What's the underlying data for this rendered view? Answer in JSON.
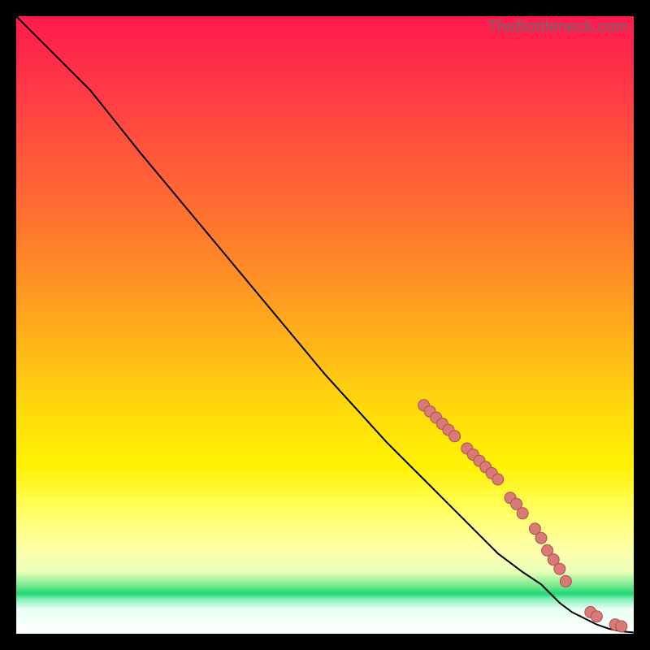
{
  "watermark": "TheBottleneck.com",
  "colors": {
    "line": "#000000",
    "marker_fill": "#d77a78",
    "marker_stroke": "#b24f4d"
  },
  "chart_data": {
    "type": "line",
    "title": "",
    "xlabel": "",
    "ylabel": "",
    "xlim": [
      0,
      100
    ],
    "ylim": [
      0,
      100
    ],
    "grid": false,
    "legend": false,
    "series": [
      {
        "name": "curve",
        "x": [
          0,
          4,
          8,
          12,
          20,
          30,
          40,
          50,
          60,
          66,
          70,
          74,
          78,
          82,
          85,
          88,
          90,
          92,
          94,
          96,
          98,
          100
        ],
        "y": [
          100,
          96,
          92,
          88,
          78,
          66,
          54,
          42,
          31,
          25,
          21,
          17,
          13,
          10,
          8,
          5,
          3.5,
          2.5,
          1.5,
          0.8,
          0.4,
          0.2
        ]
      }
    ],
    "markers": [
      {
        "x": 66,
        "y": 37
      },
      {
        "x": 67,
        "y": 36
      },
      {
        "x": 68,
        "y": 35
      },
      {
        "x": 69,
        "y": 34
      },
      {
        "x": 70,
        "y": 33
      },
      {
        "x": 71,
        "y": 32
      },
      {
        "x": 73,
        "y": 30
      },
      {
        "x": 74,
        "y": 29
      },
      {
        "x": 75,
        "y": 28
      },
      {
        "x": 76,
        "y": 27
      },
      {
        "x": 77,
        "y": 26
      },
      {
        "x": 78,
        "y": 25
      },
      {
        "x": 80,
        "y": 22
      },
      {
        "x": 81,
        "y": 21
      },
      {
        "x": 82,
        "y": 19.5
      },
      {
        "x": 84,
        "y": 17
      },
      {
        "x": 85,
        "y": 15.5
      },
      {
        "x": 86,
        "y": 13.5
      },
      {
        "x": 87,
        "y": 12
      },
      {
        "x": 88,
        "y": 10.5
      },
      {
        "x": 89,
        "y": 8.5
      },
      {
        "x": 93,
        "y": 3.5
      },
      {
        "x": 94,
        "y": 2.8
      },
      {
        "x": 97,
        "y": 1.5
      },
      {
        "x": 98,
        "y": 1.2
      }
    ]
  }
}
